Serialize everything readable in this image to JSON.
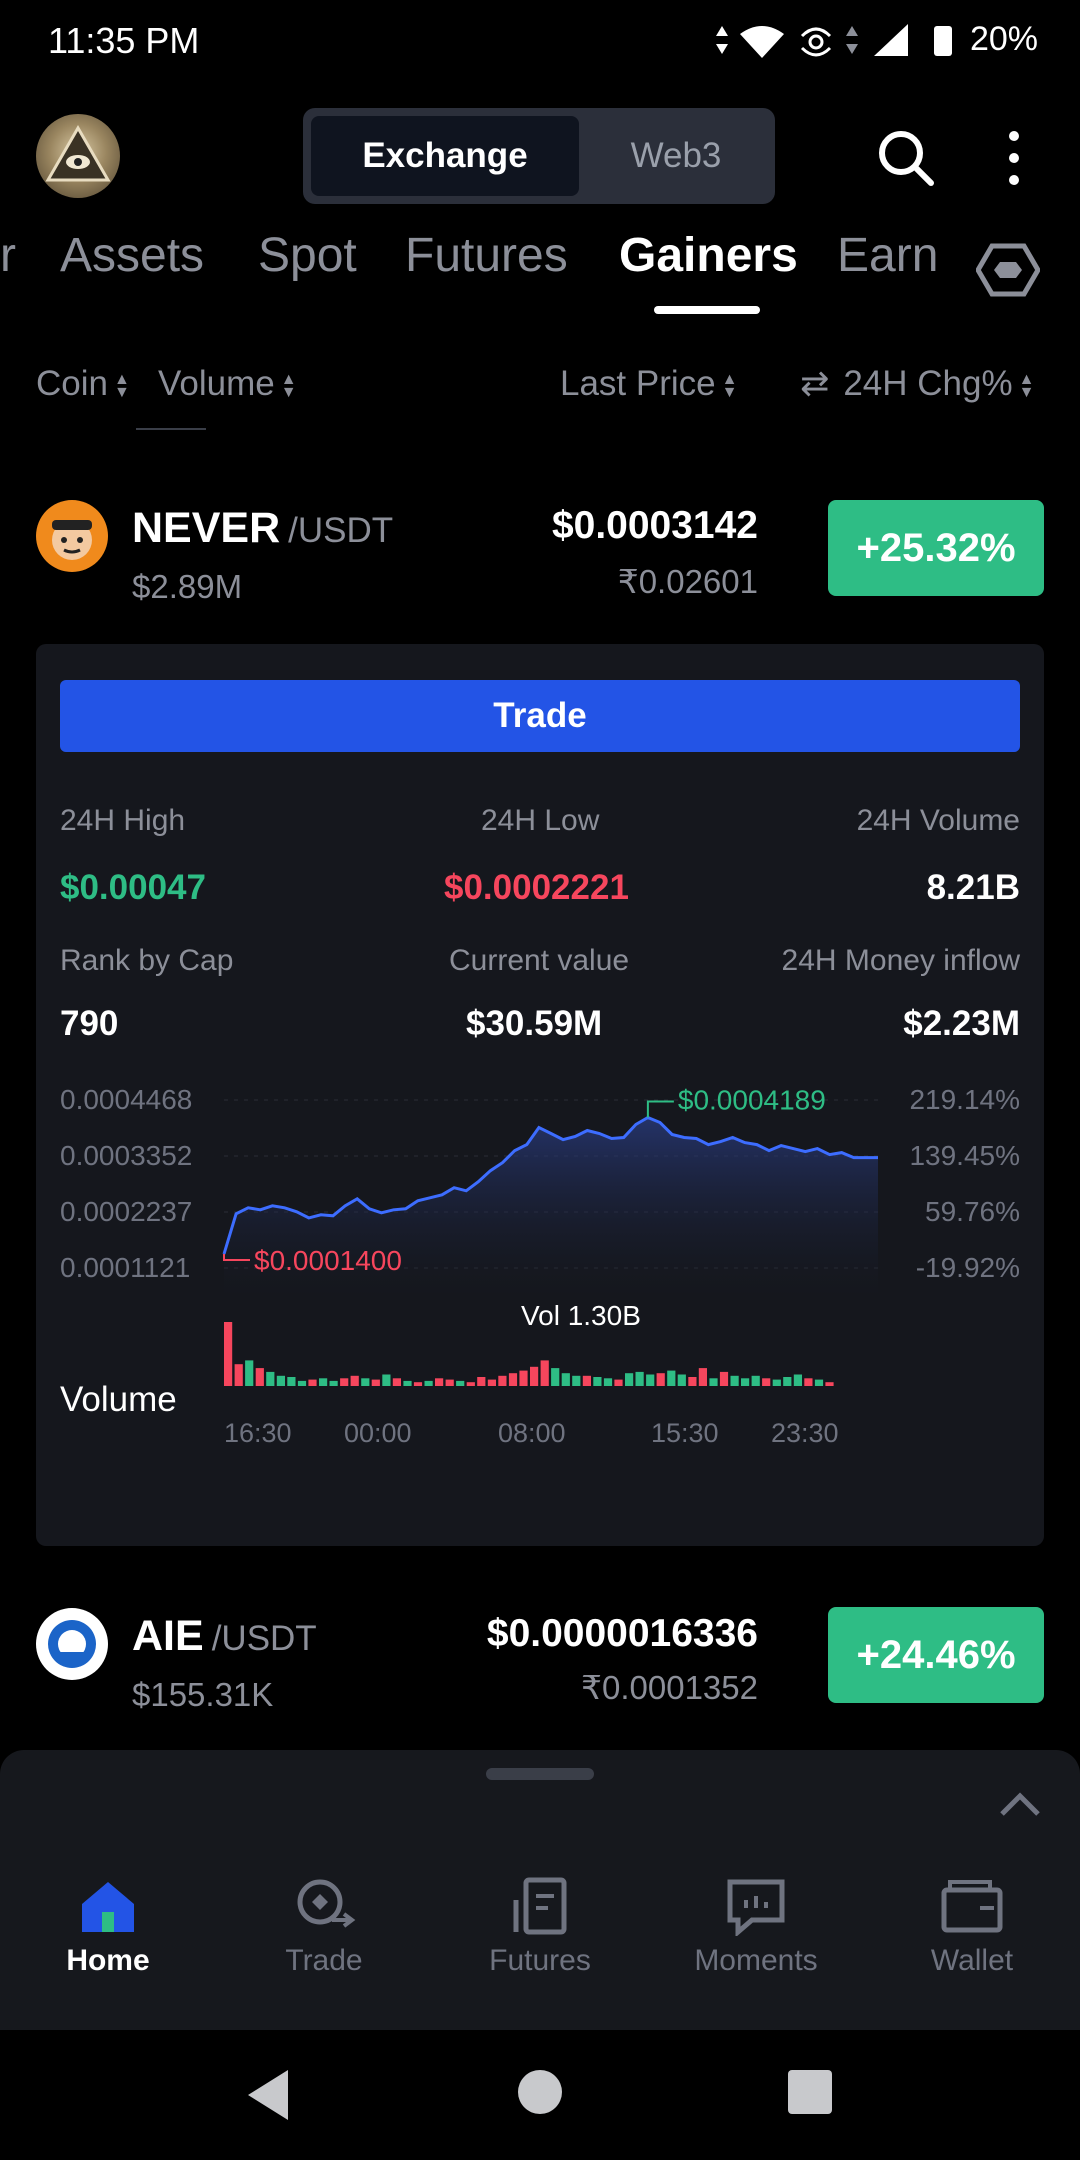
{
  "status_bar": {
    "time": "11:35 PM",
    "battery": "20%"
  },
  "header": {
    "segments": [
      "Exchange",
      "Web3"
    ],
    "active_segment": "Exchange"
  },
  "tabs": {
    "partial_left": "r",
    "items": [
      "Assets",
      "Spot",
      "Futures",
      "Gainers",
      "Earn"
    ],
    "active": "Gainers"
  },
  "sort_header": {
    "coin": "Coin",
    "volume": "Volume",
    "last_price": "Last Price",
    "change": "24H Chg%"
  },
  "rows": [
    {
      "symbol": "NEVER",
      "pair": "/USDT",
      "volume": "$2.89M",
      "price": "$0.0003142",
      "fiat": "₹0.02601",
      "change": "+25.32%"
    },
    {
      "symbol": "AIE",
      "pair": "/USDT",
      "volume": "$155.31K",
      "price": "$0.0000016336",
      "fiat": "₹0.0001352",
      "change": "+24.46%"
    }
  ],
  "detail": {
    "trade_label": "Trade",
    "high_label": "24H High",
    "high_value": "$0.00047",
    "low_label": "24H Low",
    "low_value": "$0.0002221",
    "vol_label": "24H Volume",
    "vol_value": "8.21B",
    "rank_label": "Rank by Cap",
    "rank_value": "790",
    "current_label": "Current value",
    "current_value": "$30.59M",
    "inflow_label": "24H Money inflow",
    "inflow_value": "$2.23M"
  },
  "chart_data": {
    "type": "area",
    "y_ticks_left": [
      "0.0004468",
      "0.0003352",
      "0.0002237",
      "0.0001121"
    ],
    "y_ticks_right": [
      "219.14%",
      "139.45%",
      "59.76%",
      "-19.92%"
    ],
    "max_label": "$0.0004189",
    "min_label": "$0.0001400",
    "vol_label": "Vol 1.30B",
    "volume_title": "Volume",
    "x_ticks": [
      "16:30",
      "00:00",
      "08:00",
      "15:30",
      "23:30"
    ],
    "ylim": [
      0.0001121,
      0.0004468
    ],
    "price_series": [
      0.00014,
      0.00022,
      0.000232,
      0.000228,
      0.000236,
      0.000232,
      0.000224,
      0.000212,
      0.000218,
      0.000216,
      0.000236,
      0.00025,
      0.00023,
      0.000222,
      0.000228,
      0.00023,
      0.000246,
      0.000252,
      0.000258,
      0.000272,
      0.000266,
      0.000284,
      0.000306,
      0.000322,
      0.000346,
      0.000358,
      0.000392,
      0.00038,
      0.000368,
      0.000374,
      0.000386,
      0.00038,
      0.00037,
      0.000372,
      0.000398,
      0.000412,
      0.000402,
      0.000378,
      0.000372,
      0.00037,
      0.000358,
      0.000364,
      0.000372,
      0.000362,
      0.000358,
      0.000346,
      0.000356,
      0.00035,
      0.000344,
      0.00035,
      0.000338,
      0.000342,
      0.000332,
      0.000332,
      0.000332
    ],
    "volume_bars": [
      {
        "v": 1.0,
        "up": false
      },
      {
        "v": 0.34,
        "up": false
      },
      {
        "v": 0.4,
        "up": true
      },
      {
        "v": 0.28,
        "up": false
      },
      {
        "v": 0.22,
        "up": true
      },
      {
        "v": 0.16,
        "up": true
      },
      {
        "v": 0.14,
        "up": true
      },
      {
        "v": 0.08,
        "up": true
      },
      {
        "v": 0.1,
        "up": false
      },
      {
        "v": 0.12,
        "up": true
      },
      {
        "v": 0.08,
        "up": true
      },
      {
        "v": 0.12,
        "up": false
      },
      {
        "v": 0.16,
        "up": false
      },
      {
        "v": 0.12,
        "up": true
      },
      {
        "v": 0.1,
        "up": false
      },
      {
        "v": 0.18,
        "up": true
      },
      {
        "v": 0.12,
        "up": false
      },
      {
        "v": 0.08,
        "up": true
      },
      {
        "v": 0.06,
        "up": false
      },
      {
        "v": 0.08,
        "up": true
      },
      {
        "v": 0.12,
        "up": false
      },
      {
        "v": 0.1,
        "up": false
      },
      {
        "v": 0.08,
        "up": true
      },
      {
        "v": 0.06,
        "up": false
      },
      {
        "v": 0.14,
        "up": false
      },
      {
        "v": 0.1,
        "up": false
      },
      {
        "v": 0.16,
        "up": false
      },
      {
        "v": 0.2,
        "up": false
      },
      {
        "v": 0.24,
        "up": false
      },
      {
        "v": 0.3,
        "up": false
      },
      {
        "v": 0.4,
        "up": false
      },
      {
        "v": 0.28,
        "up": true
      },
      {
        "v": 0.2,
        "up": true
      },
      {
        "v": 0.16,
        "up": true
      },
      {
        "v": 0.16,
        "up": false
      },
      {
        "v": 0.14,
        "up": true
      },
      {
        "v": 0.12,
        "up": true
      },
      {
        "v": 0.1,
        "up": false
      },
      {
        "v": 0.2,
        "up": true
      },
      {
        "v": 0.22,
        "up": true
      },
      {
        "v": 0.18,
        "up": true
      },
      {
        "v": 0.2,
        "up": false
      },
      {
        "v": 0.24,
        "up": true
      },
      {
        "v": 0.18,
        "up": true
      },
      {
        "v": 0.14,
        "up": false
      },
      {
        "v": 0.28,
        "up": false
      },
      {
        "v": 0.12,
        "up": true
      },
      {
        "v": 0.22,
        "up": false
      },
      {
        "v": 0.16,
        "up": true
      },
      {
        "v": 0.12,
        "up": true
      },
      {
        "v": 0.16,
        "up": true
      },
      {
        "v": 0.12,
        "up": false
      },
      {
        "v": 0.1,
        "up": true
      },
      {
        "v": 0.14,
        "up": true
      },
      {
        "v": 0.18,
        "up": true
      },
      {
        "v": 0.12,
        "up": false
      },
      {
        "v": 0.1,
        "up": true
      },
      {
        "v": 0.06,
        "up": false
      }
    ],
    "colors": {
      "line": "#3d6dff",
      "up": "#2ebd85",
      "down": "#f6465d",
      "max": "#2ebd85",
      "min": "#f6465d"
    }
  },
  "bottom_nav": {
    "items": [
      "Home",
      "Trade",
      "Futures",
      "Moments",
      "Wallet"
    ],
    "active": "Home",
    "icons": [
      "home-icon",
      "trade-icon",
      "futures-icon",
      "moments-icon",
      "wallet-icon"
    ]
  },
  "colors": {
    "accent_blue": "#2354e6",
    "up_green": "#2ebd85",
    "down_red": "#f6465d"
  }
}
